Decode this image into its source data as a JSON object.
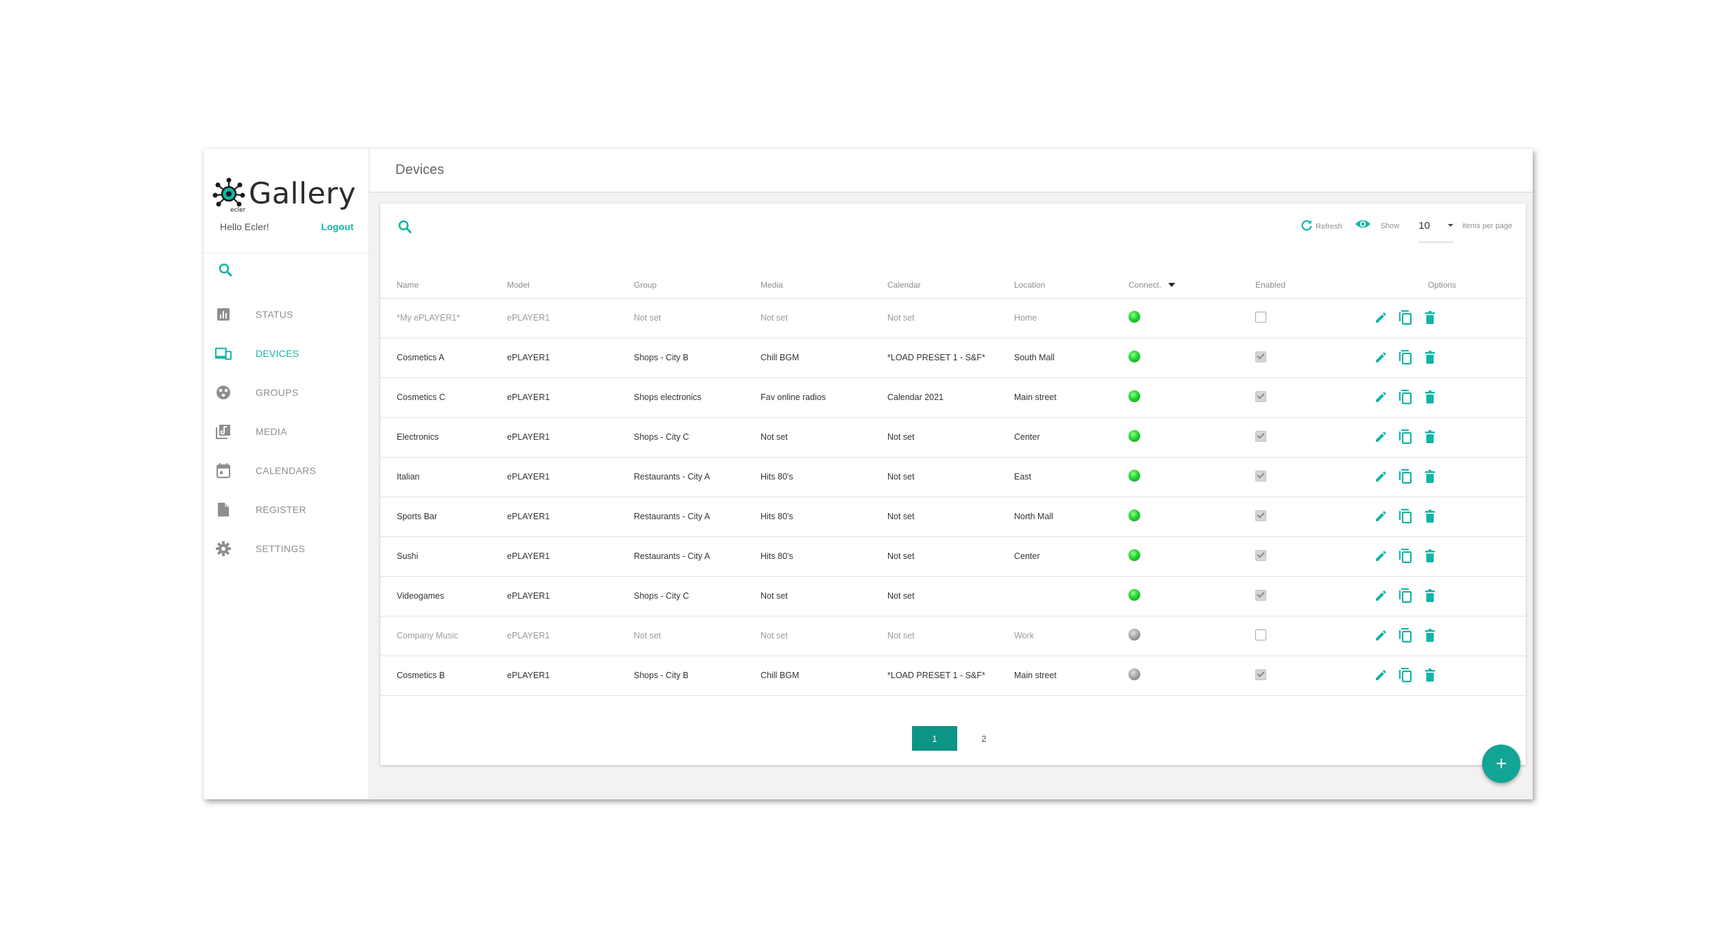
{
  "brand": {
    "logo_text": "Gallery",
    "logo_subtext": "ecler"
  },
  "user": {
    "greeting": "Hello Ecler!",
    "logout_label": "Logout"
  },
  "sidebar": {
    "items": [
      {
        "label": "STATUS",
        "icon": "bar-chart-icon",
        "active": false
      },
      {
        "label": "DEVICES",
        "icon": "devices-icon",
        "active": true
      },
      {
        "label": "GROUPS",
        "icon": "groups-icon",
        "active": false
      },
      {
        "label": "MEDIA",
        "icon": "media-library-icon",
        "active": false
      },
      {
        "label": "CALENDARS",
        "icon": "calendar-icon",
        "active": false
      },
      {
        "label": "REGISTER",
        "icon": "document-icon",
        "active": false
      },
      {
        "label": "SETTINGS",
        "icon": "gear-icon",
        "active": false
      }
    ]
  },
  "header": {
    "title": "Devices"
  },
  "toolbar": {
    "refresh_label": "Refresh",
    "show_label": "Show",
    "per_page_value": "10",
    "items_per_page_label": "items per page"
  },
  "table": {
    "headers": {
      "name": "Name",
      "model": "Model",
      "group": "Group",
      "media": "Media",
      "calendar": "Calendar",
      "location": "Location",
      "connect": "Connect.",
      "enabled": "Enabled",
      "options": "Options"
    },
    "rows": [
      {
        "name": "*My ePLAYER1*",
        "model": "ePLAYER1",
        "group": "Not set",
        "media": "Not set",
        "calendar": "Not set",
        "location": "Home",
        "connected": true,
        "enabled": false,
        "dim": true
      },
      {
        "name": "Cosmetics A",
        "model": "ePLAYER1",
        "group": "Shops - City B",
        "media": "Chill BGM",
        "calendar": "*LOAD PRESET 1 - S&F*",
        "location": "South Mall",
        "connected": true,
        "enabled": true,
        "dim": false
      },
      {
        "name": "Cosmetics C",
        "model": "ePLAYER1",
        "group": "Shops electronics",
        "media": "Fav online radios",
        "calendar": "Calendar 2021",
        "location": "Main street",
        "connected": true,
        "enabled": true,
        "dim": false
      },
      {
        "name": "Electronics",
        "model": "ePLAYER1",
        "group": "Shops - City C",
        "media": "Not set",
        "calendar": "Not set",
        "location": "Center",
        "connected": true,
        "enabled": true,
        "dim": false
      },
      {
        "name": "Italian",
        "model": "ePLAYER1",
        "group": "Restaurants - City A",
        "media": "Hits 80's",
        "calendar": "Not set",
        "location": "East",
        "connected": true,
        "enabled": true,
        "dim": false
      },
      {
        "name": "Sports Bar",
        "model": "ePLAYER1",
        "group": "Restaurants - City A",
        "media": "Hits 80's",
        "calendar": "Not set",
        "location": "North Mall",
        "connected": true,
        "enabled": true,
        "dim": false
      },
      {
        "name": "Sushi",
        "model": "ePLAYER1",
        "group": "Restaurants - City A",
        "media": "Hits 80's",
        "calendar": "Not set",
        "location": "Center",
        "connected": true,
        "enabled": true,
        "dim": false
      },
      {
        "name": "Videogames",
        "model": "ePLAYER1",
        "group": "Shops - City C",
        "media": "Not set",
        "calendar": "Not set",
        "location": "",
        "connected": true,
        "enabled": true,
        "dim": false
      },
      {
        "name": "Company Music",
        "model": "ePLAYER1",
        "group": "Not set",
        "media": "Not set",
        "calendar": "Not set",
        "location": "Work",
        "connected": false,
        "enabled": false,
        "dim": true
      },
      {
        "name": "Cosmetics B",
        "model": "ePLAYER1",
        "group": "Shops - City B",
        "media": "Chill BGM",
        "calendar": "*LOAD PRESET 1 - S&F*",
        "location": "Main street",
        "connected": false,
        "enabled": true,
        "dim": false
      }
    ]
  },
  "pagination": {
    "pages": [
      "1",
      "2"
    ],
    "current": "1"
  },
  "fab": {
    "label": "+"
  },
  "colors": {
    "accent": "#10b5a3",
    "accent_dark": "#0c9485",
    "online": "#22d42c",
    "offline": "#9c9c9c"
  }
}
